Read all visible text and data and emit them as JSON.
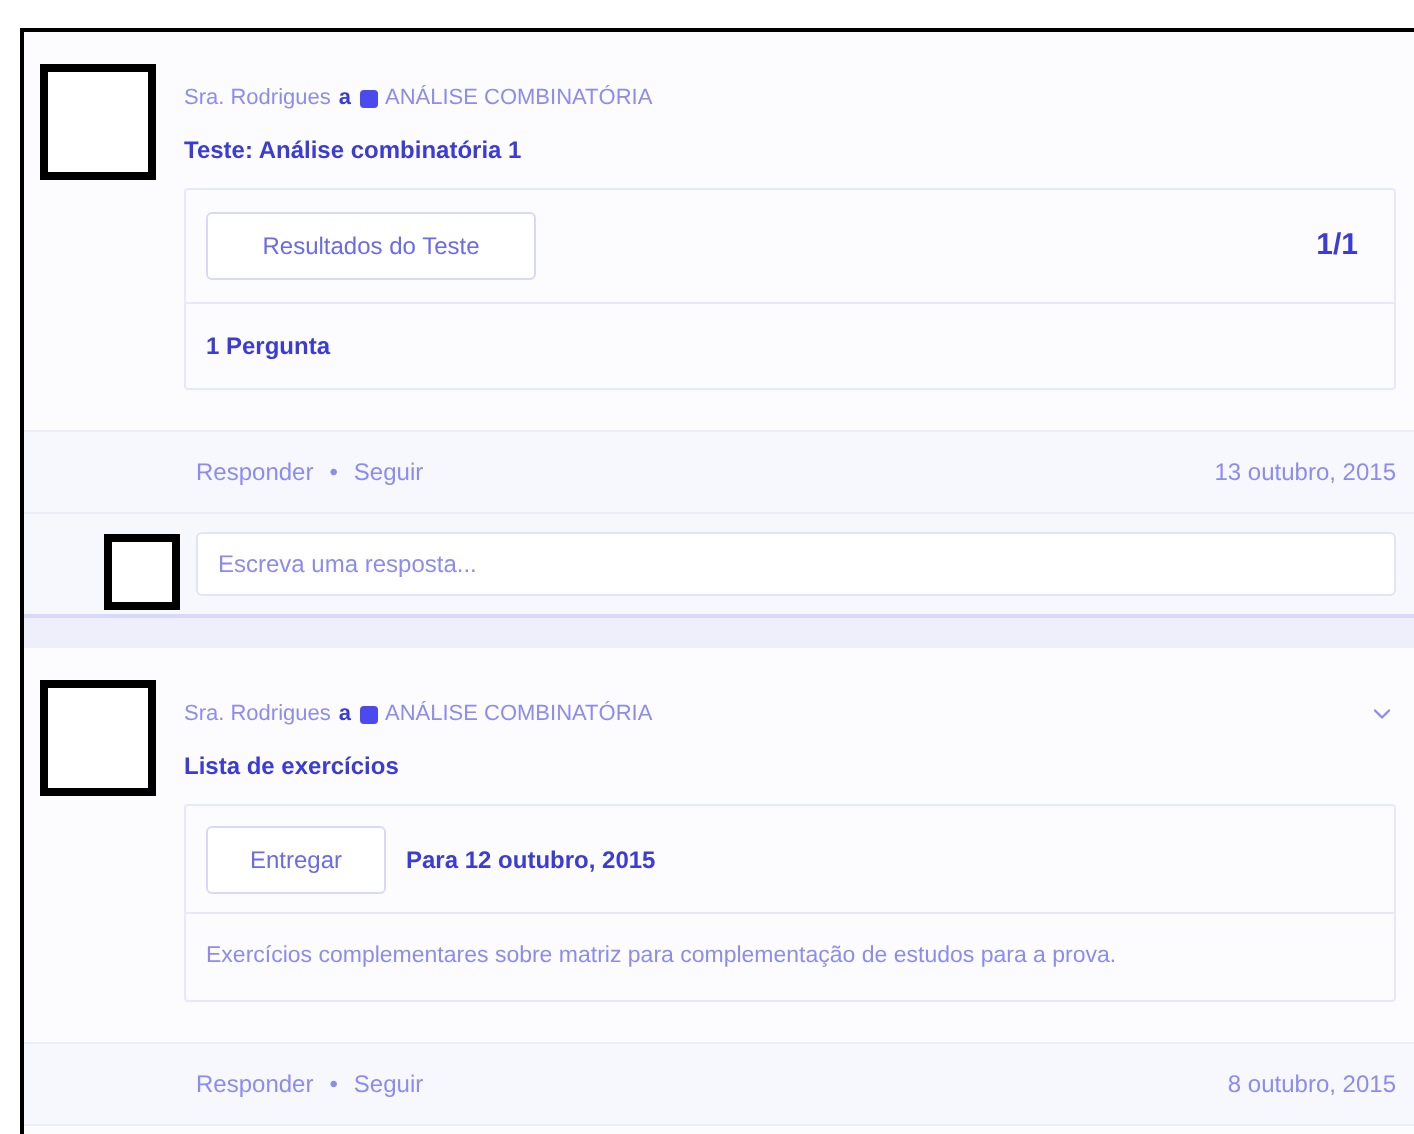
{
  "posts": [
    {
      "author": "Sra. Rodrigues",
      "connector": "a",
      "topic": "ANÁLISE COMBINATÓRIA",
      "show_menu": false,
      "title": "Teste: Análise combinatória 1",
      "attachment": {
        "kind": "quiz",
        "button": "Resultados do Teste",
        "score": "1/1",
        "detail": "1 Pergunta"
      },
      "actions": [
        "Responder",
        "Seguir"
      ],
      "separator": "•",
      "date": "13 outubro, 2015",
      "reply": {
        "placeholder": "Escreva uma resposta..."
      }
    },
    {
      "author": "Sra. Rodrigues",
      "connector": "a",
      "topic": "ANÁLISE COMBINATÓRIA",
      "show_menu": true,
      "title": "Lista de exercícios",
      "attachment": {
        "kind": "assignment",
        "button": "Entregar",
        "due": "Para 12 outubro, 2015",
        "detail": "Exercícios complementares sobre matriz para complementação de estudos para a prova."
      },
      "actions": [
        "Responder",
        "Seguir"
      ],
      "separator": "•",
      "date": "8 outubro, 2015"
    }
  ]
}
